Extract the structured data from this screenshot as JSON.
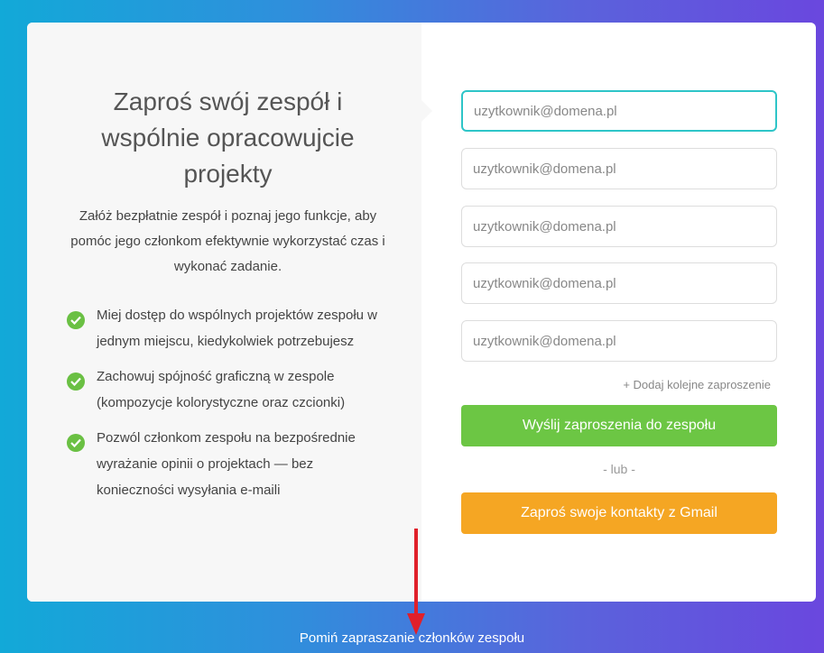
{
  "left": {
    "title": "Zaproś swój zespół i wspólnie opracowujcie projekty",
    "subtitle": "Załóż bezpłatnie zespół i poznaj jego funkcje, aby pomóc jego członkom efektywnie wykorzystać czas i wykonać zadanie.",
    "features": [
      "Miej dostęp do wspólnych projektów zespołu w jednym miejscu, kiedykolwiek potrzebujesz",
      "Zachowuj spójność graficzną w zespole (kompozycje kolorystyczne oraz czcionki)",
      "Pozwól członkom zespołu na bezpośrednie wyrażanie opinii o projektach — bez konieczności wysyłania e-maili"
    ]
  },
  "form": {
    "email_placeholder": "uzytkownik@domena.pl",
    "add_more": "+ Dodaj kolejne zaproszenie",
    "send_button": "Wyślij zaproszenia do zespołu",
    "or_text": "- lub -",
    "gmail_button": "Zaproś swoje kontakty z Gmail"
  },
  "footer": {
    "skip_link": "Pomiń zapraszanie członków zespołu"
  },
  "colors": {
    "accent_green": "#6cc644",
    "accent_orange": "#f5a623",
    "focus_teal": "#2ec5c8",
    "arrow_red": "#e0202a"
  }
}
